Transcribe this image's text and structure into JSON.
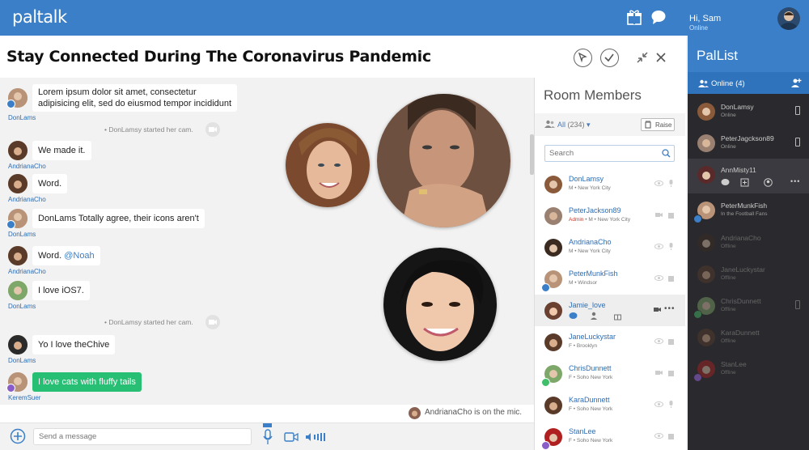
{
  "app": {
    "logo": "paltalk"
  },
  "user": {
    "greeting": "Hi, Sam",
    "status": "Online"
  },
  "room": {
    "title": "Stay Connected During The Coronavirus Pandemic"
  },
  "messages": [
    {
      "user": "DonLams",
      "text_line1": "Lorem ipsum dolor sit amet, consectetur",
      "text_line2": "adipisicing elit, sed do eiusmod tempor incididunt"
    },
    {
      "system": "DonLamsy started her cam."
    },
    {
      "user": "AndrianaCho",
      "text": "We made it."
    },
    {
      "user": "AndrianaCho",
      "text": "Word."
    },
    {
      "user": "DonLams",
      "text": "DonLams Totally agree, their icons aren't"
    },
    {
      "user": "AndrianaCho",
      "text": "Word.",
      "mention": "@Noah"
    },
    {
      "user": "DonLams",
      "text": "I love iOS7."
    },
    {
      "system": "DonLamsy started her cam."
    },
    {
      "user": "DonLams",
      "text": "Yo I love theChive"
    },
    {
      "user": "KeremSuer",
      "text": "I love cats with fluffy tails"
    }
  ],
  "mic": {
    "user": "AndrianaCho",
    "text": "is on the mic."
  },
  "composer": {
    "placeholder": "Send a message"
  },
  "members_panel": {
    "title": "Room Members",
    "filter": "All",
    "count": "(234)",
    "raise_label": "Raise",
    "search_placeholder": "Search",
    "members": [
      {
        "name": "DonLamsy",
        "meta": "M • New York City"
      },
      {
        "name": "PeterJackson89",
        "admin": "Admin",
        "meta": "• M • New York City"
      },
      {
        "name": "AndrianaCho",
        "meta": "M • New York City"
      },
      {
        "name": "PeterMunkFish",
        "meta": "M • Windsor"
      },
      {
        "name": "Jamie_love"
      },
      {
        "name": "JaneLuckystar",
        "meta": "F • Brooklyn"
      },
      {
        "name": "ChrisDunnett",
        "meta": "F • Soho New York"
      },
      {
        "name": "KaraDunnett",
        "meta": "F • Soho New York"
      },
      {
        "name": "StanLee",
        "meta": "F • Soho New York"
      }
    ]
  },
  "pallist": {
    "title": "PalList",
    "online_label": "Online (4)",
    "pals": [
      {
        "name": "DonLamsy",
        "status": "Online"
      },
      {
        "name": "PeterJagckson89",
        "status": "Online"
      },
      {
        "name": "AnnMisty11"
      },
      {
        "name": "PeterMunkFish",
        "status": "In the Football Fans"
      },
      {
        "name": "AndrianaCho",
        "status": "Offline"
      },
      {
        "name": "JaneLuckystar",
        "status": "Offline"
      },
      {
        "name": "ChrisDunnett",
        "status": "Offline"
      },
      {
        "name": "KaraDunnett",
        "status": "Offline"
      },
      {
        "name": "StanLee",
        "status": "Offline"
      }
    ]
  },
  "colors": {
    "brand": "#3a7fc8",
    "green_bubble": "#27bf74",
    "sidebar_bg": "#2a2a2e"
  }
}
